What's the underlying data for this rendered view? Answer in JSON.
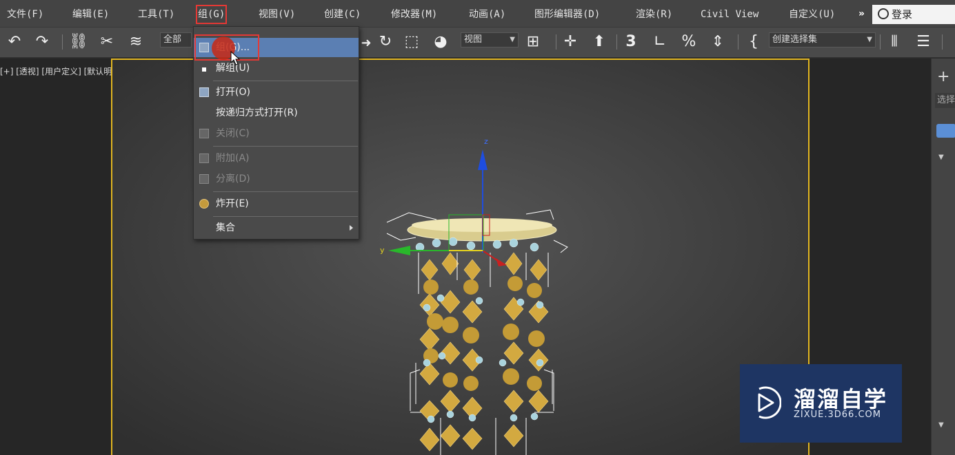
{
  "menubar": {
    "items": [
      "文件(F)",
      "编辑(E)",
      "工具(T)",
      "组(G)",
      "视图(V)",
      "创建(C)",
      "修改器(M)",
      "动画(A)",
      "图形编辑器(D)",
      "渲染(R)",
      "Civil View",
      "自定义(U)"
    ],
    "more": "»",
    "login": "登录"
  },
  "toolbar": {
    "select_all": "全部",
    "view_select": "视图",
    "selection_set": "创建选择集"
  },
  "viewport": {
    "label": "[+] [透视] [用户定义] [默认明暗处理]"
  },
  "dropdown": {
    "items": [
      {
        "label": "组(G)...",
        "disabled": false
      },
      {
        "label": "解组(U)",
        "disabled": false
      },
      {
        "label": "打开(O)",
        "disabled": false
      },
      {
        "label": "按递归方式打开(R)",
        "disabled": false
      },
      {
        "label": "关闭(C)",
        "disabled": true
      },
      {
        "label": "附加(A)",
        "disabled": true
      },
      {
        "label": "分离(D)",
        "disabled": true
      },
      {
        "label": "炸开(E)",
        "disabled": false
      },
      {
        "label": "集合",
        "disabled": false
      }
    ]
  },
  "cmd_panel": {
    "select_text": "选择",
    "rollout_1": "▼ ",
    "rollout_2": "▼ "
  },
  "gizmo": {
    "z_label": "z",
    "y_label": "y"
  },
  "watermark": {
    "title": "溜溜自学",
    "subtitle": "ZIXUE.3D66.COM"
  }
}
